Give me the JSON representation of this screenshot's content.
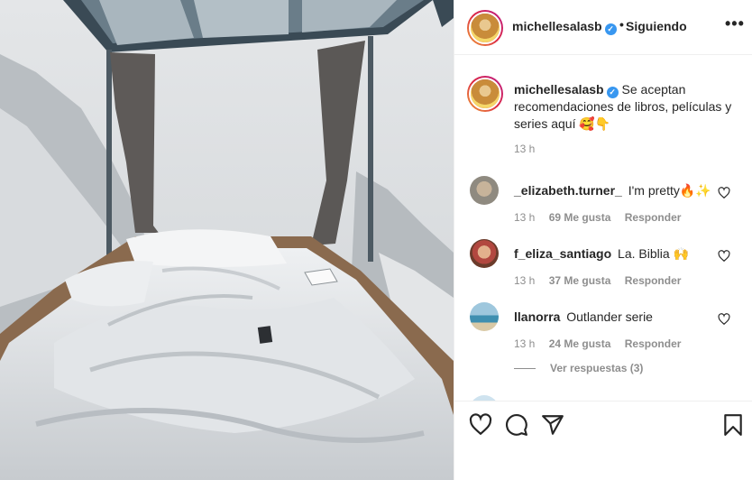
{
  "header": {
    "username": "michellesalasb",
    "verified_mark": "✓",
    "separator": "•",
    "follow_status": "Siguiendo",
    "more": "•••"
  },
  "caption": {
    "username": "michellesalasb",
    "text": "Se aceptan recomendaciones de libros, películas y series aquí 🥰👇",
    "time": "13 h"
  },
  "comments": [
    {
      "username": "_elizabeth.turner_",
      "text": "I'm pretty🔥✨",
      "time": "13 h",
      "likes": "69 Me gusta",
      "reply": "Responder"
    },
    {
      "username": "f_eliza_santiago",
      "text": "La. Biblia 🙌",
      "time": "13 h",
      "likes": "37 Me gusta",
      "reply": "Responder"
    },
    {
      "username": "llanorra",
      "text": "Outlander serie",
      "time": "13 h",
      "likes": "24 Me gusta",
      "reply": "Responder"
    }
  ],
  "view_replies": "Ver respuestas (3)",
  "icons": {
    "like": "heart-icon",
    "comment": "comment-icon",
    "share": "share-icon",
    "save": "bookmark-icon",
    "verified": "verified-badge-icon"
  },
  "colors": {
    "text": "#262626",
    "secondary": "#8e8e8e",
    "verified": "#3897f0",
    "border": "#efefef"
  }
}
